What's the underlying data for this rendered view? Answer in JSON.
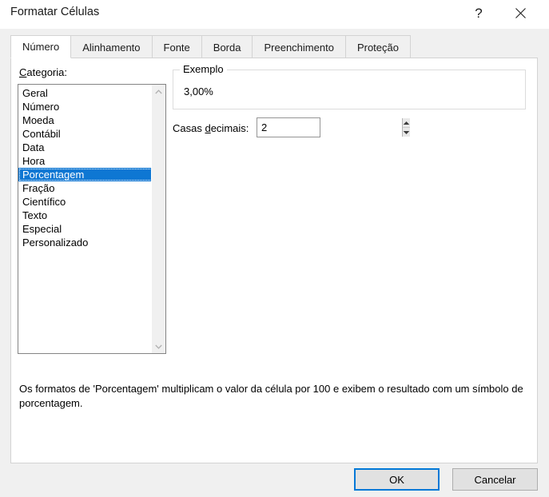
{
  "window": {
    "title": "Formatar Células",
    "help_icon": "help-question-icon",
    "help_glyph": "?",
    "close_icon": "close-icon"
  },
  "tabs": [
    {
      "label": "Número",
      "active": true
    },
    {
      "label": "Alinhamento",
      "active": false
    },
    {
      "label": "Fonte",
      "active": false
    },
    {
      "label": "Borda",
      "active": false
    },
    {
      "label": "Preenchimento",
      "active": false
    },
    {
      "label": "Proteção",
      "active": false
    }
  ],
  "category": {
    "label_prefix": "",
    "label_accel": "C",
    "label_suffix": "ategoria:",
    "items": [
      {
        "label": "Geral",
        "selected": false
      },
      {
        "label": "Número",
        "selected": false
      },
      {
        "label": "Moeda",
        "selected": false
      },
      {
        "label": "Contábil",
        "selected": false
      },
      {
        "label": "Data",
        "selected": false
      },
      {
        "label": "Hora",
        "selected": false
      },
      {
        "label": "Porcentagem",
        "selected": true
      },
      {
        "label": "Fração",
        "selected": false
      },
      {
        "label": "Científico",
        "selected": false
      },
      {
        "label": "Texto",
        "selected": false
      },
      {
        "label": "Especial",
        "selected": false
      },
      {
        "label": "Personalizado",
        "selected": false
      }
    ],
    "scrollbar": {
      "up_icon": "chevron-up-icon",
      "down_icon": "chevron-down-icon"
    }
  },
  "example": {
    "legend": "Exemplo",
    "value": "3,00%"
  },
  "decimals": {
    "label_prefix": "Casas ",
    "label_accel": "d",
    "label_suffix": "ecimais:",
    "value": "2",
    "spinner_up_icon": "spinner-up-arrow-icon",
    "spinner_down_icon": "spinner-down-arrow-icon"
  },
  "description": "Os formatos de 'Porcentagem' multiplicam o valor da célula por 100 e exibem o resultado com um símbolo de porcentagem.",
  "footer": {
    "ok_label": "OK",
    "cancel_label": "Cancelar"
  },
  "colors": {
    "selection_blue": "#0e77d3",
    "focus_blue": "#0078d7",
    "dialog_background": "#f0f0f0",
    "panel_background": "#ffffff"
  }
}
